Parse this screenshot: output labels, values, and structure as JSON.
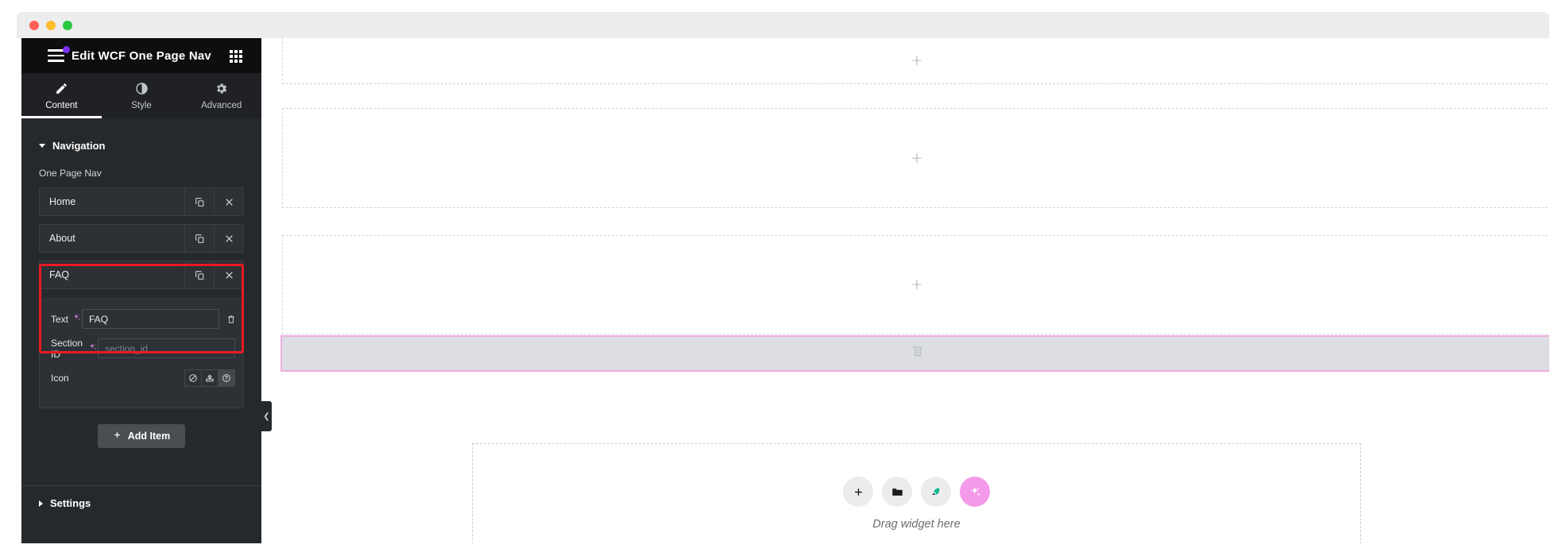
{
  "window": {
    "traffic_lights": [
      "close",
      "minimize",
      "maximize"
    ]
  },
  "panel": {
    "title": "Edit WCF One Page Nav",
    "hamburger_icon": "hamburger-icon",
    "grid_icon": "grid-icon",
    "tabs": [
      {
        "label": "Content",
        "icon": "pencil-icon",
        "active": true
      },
      {
        "label": "Style",
        "icon": "contrast-icon",
        "active": false
      },
      {
        "label": "Advanced",
        "icon": "gear-icon",
        "active": false
      }
    ],
    "sections": [
      {
        "label": "Navigation",
        "expanded": true
      },
      {
        "label": "Settings",
        "expanded": false
      }
    ],
    "repeater": {
      "label": "One Page Nav",
      "items": [
        {
          "title": "Home",
          "duplicate_icon": "duplicate-icon",
          "remove_icon": "close-icon"
        },
        {
          "title": "About",
          "duplicate_icon": "duplicate-icon",
          "remove_icon": "close-icon"
        },
        {
          "title": "FAQ",
          "duplicate_icon": "duplicate-icon",
          "remove_icon": "close-icon"
        }
      ],
      "add_item_label": "Add Item",
      "add_item_icon": "plus-icon"
    },
    "expanded_item": {
      "text_label": "Text",
      "text_value": "FAQ",
      "text_ai_icon": "ai-sparkle-icon",
      "text_clear_icon": "trash-icon",
      "section_id_label": "Section ID",
      "section_id_value": "",
      "section_id_placeholder": "section_id",
      "section_id_ai_icon": "ai-sparkle-icon",
      "icon_label": "Icon",
      "icon_options": [
        {
          "name": "none-icon",
          "active": false
        },
        {
          "name": "upload-icon",
          "active": false
        },
        {
          "name": "help-circle-icon",
          "active": true
        }
      ]
    },
    "highlight_color": "#e81b23",
    "collapse_handle_icon": "chevron-left-icon"
  },
  "canvas": {
    "empty_sections": [
      {
        "add_icon": "plus-icon"
      },
      {
        "add_icon": "plus-icon"
      },
      {
        "add_icon": "plus-icon"
      }
    ],
    "selected_section": {
      "widget_icon": "nav-widget-icon",
      "border_color": "#f0aee0",
      "background_color": "#dcdee3"
    },
    "drop_zone": {
      "hint": "Drag widget here",
      "buttons": [
        {
          "name": "add-widget-button",
          "icon": "plus-icon",
          "accent": "#ececec"
        },
        {
          "name": "folder-templates-button",
          "icon": "folder-icon",
          "accent": "#ececec"
        },
        {
          "name": "cloud-library-button",
          "icon": "leaf-icon",
          "accent": "#ececec"
        },
        {
          "name": "ai-builder-button",
          "icon": "ai-sparkle-icon",
          "accent": "#f49ae8"
        }
      ]
    }
  }
}
